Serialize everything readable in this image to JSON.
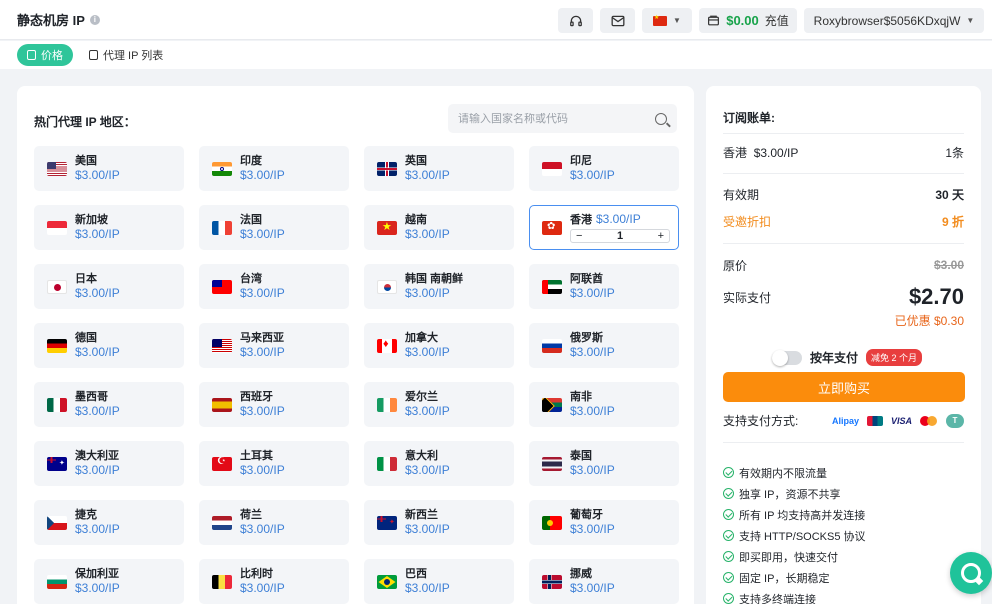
{
  "header": {
    "title": "静态机房 IP",
    "balance": "$0.00",
    "recharge_label": "充值",
    "username": "Roxybrowser$5056KDxqjW"
  },
  "tabs": [
    {
      "label": "价格",
      "active": true
    },
    {
      "label": "代理 IP 列表",
      "active": false
    }
  ],
  "region": {
    "label": "热门代理 IP 地区：",
    "search_placeholder": "请输入国家名称或代码"
  },
  "countries": [
    {
      "name": "美国",
      "price": "$3.00/IP",
      "flag": "us"
    },
    {
      "name": "印度",
      "price": "$3.00/IP",
      "flag": "in"
    },
    {
      "name": "英国",
      "price": "$3.00/IP",
      "flag": "gb"
    },
    {
      "name": "印尼",
      "price": "$3.00/IP",
      "flag": "id"
    },
    {
      "name": "新加坡",
      "price": "$3.00/IP",
      "flag": "sg"
    },
    {
      "name": "法国",
      "price": "$3.00/IP",
      "flag": "fr"
    },
    {
      "name": "越南",
      "price": "$3.00/IP",
      "flag": "vn"
    },
    {
      "name": "香港",
      "price": "$3.00/IP",
      "flag": "hk",
      "selected": true,
      "qty": "1"
    },
    {
      "name": "日本",
      "price": "$3.00/IP",
      "flag": "jp"
    },
    {
      "name": "台湾",
      "price": "$3.00/IP",
      "flag": "tw"
    },
    {
      "name": "韩国 南朝鲜",
      "price": "$3.00/IP",
      "flag": "kr"
    },
    {
      "name": "阿联酋",
      "price": "$3.00/IP",
      "flag": "ae"
    },
    {
      "name": "德国",
      "price": "$3.00/IP",
      "flag": "de"
    },
    {
      "name": "马来西亚",
      "price": "$3.00/IP",
      "flag": "my"
    },
    {
      "name": "加拿大",
      "price": "$3.00/IP",
      "flag": "ca"
    },
    {
      "name": "俄罗斯",
      "price": "$3.00/IP",
      "flag": "ru"
    },
    {
      "name": "墨西哥",
      "price": "$3.00/IP",
      "flag": "mx"
    },
    {
      "name": "西班牙",
      "price": "$3.00/IP",
      "flag": "es"
    },
    {
      "name": "爱尔兰",
      "price": "$3.00/IP",
      "flag": "ie"
    },
    {
      "name": "南非",
      "price": "$3.00/IP",
      "flag": "za"
    },
    {
      "name": "澳大利亚",
      "price": "$3.00/IP",
      "flag": "au"
    },
    {
      "name": "土耳其",
      "price": "$3.00/IP",
      "flag": "tr"
    },
    {
      "name": "意大利",
      "price": "$3.00/IP",
      "flag": "it"
    },
    {
      "name": "泰国",
      "price": "$3.00/IP",
      "flag": "th"
    },
    {
      "name": "捷克",
      "price": "$3.00/IP",
      "flag": "cz"
    },
    {
      "name": "荷兰",
      "price": "$3.00/IP",
      "flag": "nl"
    },
    {
      "name": "新西兰",
      "price": "$3.00/IP",
      "flag": "nz"
    },
    {
      "name": "葡萄牙",
      "price": "$3.00/IP",
      "flag": "pt"
    },
    {
      "name": "保加利亚",
      "price": "$3.00/IP",
      "flag": "bg"
    },
    {
      "name": "比利时",
      "price": "$3.00/IP",
      "flag": "be"
    },
    {
      "name": "巴西",
      "price": "$3.00/IP",
      "flag": "br"
    },
    {
      "name": "挪威",
      "price": "$3.00/IP",
      "flag": "no"
    }
  ],
  "order": {
    "title": "订阅账单:",
    "item_label": "香港",
    "item_price": "$3.00/IP",
    "item_count": "1条",
    "validity_label": "有效期",
    "validity_value": "30 天",
    "discount_label": "受邀折扣",
    "discount_value": "9 折",
    "original_label": "原价",
    "original_value": "$3.00",
    "actual_label": "实际支付",
    "actual_value": "$2.70",
    "saved_text": "已优惠 $0.30",
    "monthly_label": "按年支付",
    "monthly_badge": "减免 2 个月",
    "buy_label": "立即购买",
    "payment_label": "支持支付方式:",
    "alipay": "Alipay",
    "visa": "VISA",
    "tether": "T"
  },
  "features": [
    "有效期内不限流量",
    "独享 IP，资源不共享",
    "所有 IP 均支持高并发连接",
    "支持 HTTP/SOCKS5 协议",
    "即买即用，快速交付",
    "固定 IP，长期稳定",
    "支持多终端连接"
  ],
  "colors": {
    "accent": "#2fc59a",
    "price_blue": "#3d7fd6",
    "buy_orange": "#fb8c0c",
    "balance_green": "#17a34a"
  },
  "icons": {
    "support": "headphones-icon",
    "mail": "mail-icon",
    "wallet": "wallet-icon",
    "chat": "chat-icon"
  }
}
